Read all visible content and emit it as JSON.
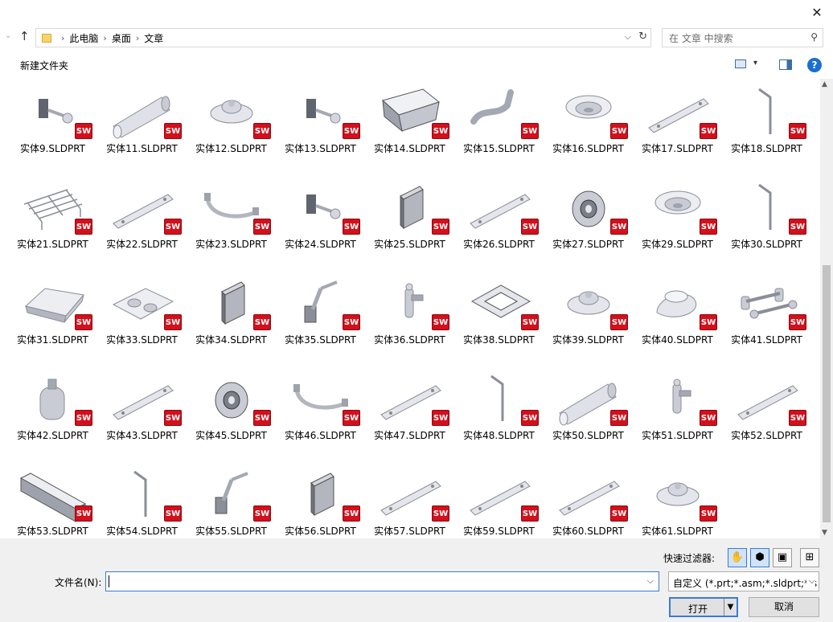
{
  "window": {
    "close_glyph": "✕"
  },
  "address": {
    "breadcrumbs": [
      "此电脑",
      "桌面",
      "文章"
    ],
    "search_placeholder": "在 文章 中搜索"
  },
  "toolbar": {
    "new_folder_label": "新建文件夹",
    "help_glyph": "?"
  },
  "files": [
    {
      "name": "实体9.SLDPRT",
      "shape": "bracket-knob"
    },
    {
      "name": "实体11.SLDPRT",
      "shape": "cylinder"
    },
    {
      "name": "实体12.SLDPRT",
      "shape": "knob"
    },
    {
      "name": "实体13.SLDPRT",
      "shape": "bracket-knob"
    },
    {
      "name": "实体14.SLDPRT",
      "shape": "tray"
    },
    {
      "name": "实体15.SLDPRT",
      "shape": "pipe"
    },
    {
      "name": "实体16.SLDPRT",
      "shape": "bowl"
    },
    {
      "name": "实体17.SLDPRT",
      "shape": "bar"
    },
    {
      "name": "实体18.SLDPRT",
      "shape": "rod"
    },
    {
      "name": "实体21.SLDPRT",
      "shape": "grill"
    },
    {
      "name": "实体22.SLDPRT",
      "shape": "bar"
    },
    {
      "name": "实体23.SLDPRT",
      "shape": "handle"
    },
    {
      "name": "实体24.SLDPRT",
      "shape": "bracket-knob"
    },
    {
      "name": "实体25.SLDPRT",
      "shape": "angle"
    },
    {
      "name": "实体26.SLDPRT",
      "shape": "bar"
    },
    {
      "name": "实体27.SLDPRT",
      "shape": "wheel"
    },
    {
      "name": "实体29.SLDPRT",
      "shape": "bowl"
    },
    {
      "name": "实体30.SLDPRT",
      "shape": "rod"
    },
    {
      "name": "实体31.SLDPRT",
      "shape": "basin"
    },
    {
      "name": "实体33.SLDPRT",
      "shape": "plate"
    },
    {
      "name": "实体34.SLDPRT",
      "shape": "angle"
    },
    {
      "name": "实体35.SLDPRT",
      "shape": "arm"
    },
    {
      "name": "实体36.SLDPRT",
      "shape": "valve"
    },
    {
      "name": "实体38.SLDPRT",
      "shape": "frame"
    },
    {
      "name": "实体39.SLDPRT",
      "shape": "knob"
    },
    {
      "name": "实体40.SLDPRT",
      "shape": "cap"
    },
    {
      "name": "实体41.SLDPRT",
      "shape": "assembly"
    },
    {
      "name": "实体42.SLDPRT",
      "shape": "tank"
    },
    {
      "name": "实体43.SLDPRT",
      "shape": "bar"
    },
    {
      "name": "实体45.SLDPRT",
      "shape": "wheel"
    },
    {
      "name": "实体46.SLDPRT",
      "shape": "handle"
    },
    {
      "name": "实体47.SLDPRT",
      "shape": "bar"
    },
    {
      "name": "实体48.SLDPRT",
      "shape": "rod"
    },
    {
      "name": "实体50.SLDPRT",
      "shape": "cylinder"
    },
    {
      "name": "实体51.SLDPRT",
      "shape": "valve"
    },
    {
      "name": "实体52.SLDPRT",
      "shape": "bar"
    },
    {
      "name": "实体53.SLDPRT",
      "shape": "beam"
    },
    {
      "name": "实体54.SLDPRT",
      "shape": "rod"
    },
    {
      "name": "实体55.SLDPRT",
      "shape": "arm"
    },
    {
      "name": "实体56.SLDPRT",
      "shape": "angle"
    },
    {
      "name": "实体57.SLDPRT",
      "shape": "bar"
    },
    {
      "name": "实体59.SLDPRT",
      "shape": "bar"
    },
    {
      "name": "实体60.SLDPRT",
      "shape": "bar"
    },
    {
      "name": "实体61.SLDPRT",
      "shape": "knob"
    }
  ],
  "badge_text": "SW",
  "bottom": {
    "quick_filter_label": "快速过滤器:",
    "file_name_label": "文件名(N):",
    "file_name_value": "",
    "file_type_value": "自定义 (*.prt;*.asm;*.sldprt;*.s",
    "open_label": "打开",
    "cancel_label": "取消"
  },
  "colors": {
    "accent": "#3a7bd5",
    "badge": "#d3101b"
  }
}
